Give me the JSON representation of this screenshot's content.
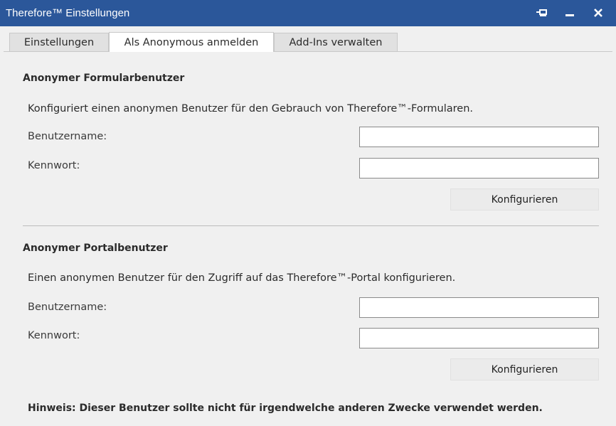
{
  "window": {
    "title": "Therefore™ Einstellungen",
    "colors": {
      "titlebar": "#2b579a",
      "background": "#f0f0f0"
    },
    "controls": [
      "pin-icon",
      "minimize-icon",
      "close-icon"
    ]
  },
  "tabs": [
    {
      "label": "Einstellungen",
      "active": false
    },
    {
      "label": "Als Anonymous anmelden",
      "active": true
    },
    {
      "label": "Add-Ins verwalten",
      "active": false
    }
  ],
  "form_user": {
    "title": "Anonymer Formularbenutzer",
    "description": "Konfiguriert einen anonymen Benutzer für den Gebrauch von Therefore™-Formularen.",
    "username_label": "Benutzername:",
    "username_value": "",
    "password_label": "Kennwort:",
    "password_value": "",
    "configure_label": "Konfigurieren"
  },
  "portal_user": {
    "title": "Anonymer Portalbenutzer",
    "description": "Einen anonymen Benutzer für den Zugriff auf das Therefore™-Portal konfigurieren.",
    "username_label": "Benutzername:",
    "username_value": "",
    "password_label": "Kennwort:",
    "password_value": "",
    "configure_label": "Konfigurieren"
  },
  "note": "Hinweis: Dieser Benutzer sollte nicht für irgendwelche anderen Zwecke verwendet werden."
}
